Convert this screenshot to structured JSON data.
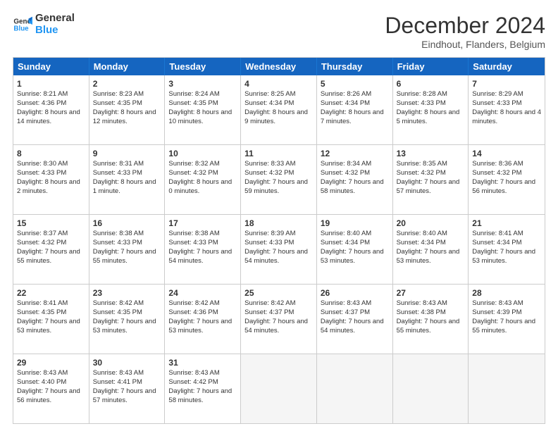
{
  "logo": {
    "line1": "General",
    "line2": "Blue"
  },
  "title": "December 2024",
  "location": "Eindhout, Flanders, Belgium",
  "weekdays": [
    "Sunday",
    "Monday",
    "Tuesday",
    "Wednesday",
    "Thursday",
    "Friday",
    "Saturday"
  ],
  "rows": [
    [
      {
        "day": "1",
        "sunrise": "Sunrise: 8:21 AM",
        "sunset": "Sunset: 4:36 PM",
        "daylight": "Daylight: 8 hours and 14 minutes."
      },
      {
        "day": "2",
        "sunrise": "Sunrise: 8:23 AM",
        "sunset": "Sunset: 4:35 PM",
        "daylight": "Daylight: 8 hours and 12 minutes."
      },
      {
        "day": "3",
        "sunrise": "Sunrise: 8:24 AM",
        "sunset": "Sunset: 4:35 PM",
        "daylight": "Daylight: 8 hours and 10 minutes."
      },
      {
        "day": "4",
        "sunrise": "Sunrise: 8:25 AM",
        "sunset": "Sunset: 4:34 PM",
        "daylight": "Daylight: 8 hours and 9 minutes."
      },
      {
        "day": "5",
        "sunrise": "Sunrise: 8:26 AM",
        "sunset": "Sunset: 4:34 PM",
        "daylight": "Daylight: 8 hours and 7 minutes."
      },
      {
        "day": "6",
        "sunrise": "Sunrise: 8:28 AM",
        "sunset": "Sunset: 4:33 PM",
        "daylight": "Daylight: 8 hours and 5 minutes."
      },
      {
        "day": "7",
        "sunrise": "Sunrise: 8:29 AM",
        "sunset": "Sunset: 4:33 PM",
        "daylight": "Daylight: 8 hours and 4 minutes."
      }
    ],
    [
      {
        "day": "8",
        "sunrise": "Sunrise: 8:30 AM",
        "sunset": "Sunset: 4:33 PM",
        "daylight": "Daylight: 8 hours and 2 minutes."
      },
      {
        "day": "9",
        "sunrise": "Sunrise: 8:31 AM",
        "sunset": "Sunset: 4:33 PM",
        "daylight": "Daylight: 8 hours and 1 minute."
      },
      {
        "day": "10",
        "sunrise": "Sunrise: 8:32 AM",
        "sunset": "Sunset: 4:32 PM",
        "daylight": "Daylight: 8 hours and 0 minutes."
      },
      {
        "day": "11",
        "sunrise": "Sunrise: 8:33 AM",
        "sunset": "Sunset: 4:32 PM",
        "daylight": "Daylight: 7 hours and 59 minutes."
      },
      {
        "day": "12",
        "sunrise": "Sunrise: 8:34 AM",
        "sunset": "Sunset: 4:32 PM",
        "daylight": "Daylight: 7 hours and 58 minutes."
      },
      {
        "day": "13",
        "sunrise": "Sunrise: 8:35 AM",
        "sunset": "Sunset: 4:32 PM",
        "daylight": "Daylight: 7 hours and 57 minutes."
      },
      {
        "day": "14",
        "sunrise": "Sunrise: 8:36 AM",
        "sunset": "Sunset: 4:32 PM",
        "daylight": "Daylight: 7 hours and 56 minutes."
      }
    ],
    [
      {
        "day": "15",
        "sunrise": "Sunrise: 8:37 AM",
        "sunset": "Sunset: 4:32 PM",
        "daylight": "Daylight: 7 hours and 55 minutes."
      },
      {
        "day": "16",
        "sunrise": "Sunrise: 8:38 AM",
        "sunset": "Sunset: 4:33 PM",
        "daylight": "Daylight: 7 hours and 55 minutes."
      },
      {
        "day": "17",
        "sunrise": "Sunrise: 8:38 AM",
        "sunset": "Sunset: 4:33 PM",
        "daylight": "Daylight: 7 hours and 54 minutes."
      },
      {
        "day": "18",
        "sunrise": "Sunrise: 8:39 AM",
        "sunset": "Sunset: 4:33 PM",
        "daylight": "Daylight: 7 hours and 54 minutes."
      },
      {
        "day": "19",
        "sunrise": "Sunrise: 8:40 AM",
        "sunset": "Sunset: 4:34 PM",
        "daylight": "Daylight: 7 hours and 53 minutes."
      },
      {
        "day": "20",
        "sunrise": "Sunrise: 8:40 AM",
        "sunset": "Sunset: 4:34 PM",
        "daylight": "Daylight: 7 hours and 53 minutes."
      },
      {
        "day": "21",
        "sunrise": "Sunrise: 8:41 AM",
        "sunset": "Sunset: 4:34 PM",
        "daylight": "Daylight: 7 hours and 53 minutes."
      }
    ],
    [
      {
        "day": "22",
        "sunrise": "Sunrise: 8:41 AM",
        "sunset": "Sunset: 4:35 PM",
        "daylight": "Daylight: 7 hours and 53 minutes."
      },
      {
        "day": "23",
        "sunrise": "Sunrise: 8:42 AM",
        "sunset": "Sunset: 4:35 PM",
        "daylight": "Daylight: 7 hours and 53 minutes."
      },
      {
        "day": "24",
        "sunrise": "Sunrise: 8:42 AM",
        "sunset": "Sunset: 4:36 PM",
        "daylight": "Daylight: 7 hours and 53 minutes."
      },
      {
        "day": "25",
        "sunrise": "Sunrise: 8:42 AM",
        "sunset": "Sunset: 4:37 PM",
        "daylight": "Daylight: 7 hours and 54 minutes."
      },
      {
        "day": "26",
        "sunrise": "Sunrise: 8:43 AM",
        "sunset": "Sunset: 4:37 PM",
        "daylight": "Daylight: 7 hours and 54 minutes."
      },
      {
        "day": "27",
        "sunrise": "Sunrise: 8:43 AM",
        "sunset": "Sunset: 4:38 PM",
        "daylight": "Daylight: 7 hours and 55 minutes."
      },
      {
        "day": "28",
        "sunrise": "Sunrise: 8:43 AM",
        "sunset": "Sunset: 4:39 PM",
        "daylight": "Daylight: 7 hours and 55 minutes."
      }
    ],
    [
      {
        "day": "29",
        "sunrise": "Sunrise: 8:43 AM",
        "sunset": "Sunset: 4:40 PM",
        "daylight": "Daylight: 7 hours and 56 minutes."
      },
      {
        "day": "30",
        "sunrise": "Sunrise: 8:43 AM",
        "sunset": "Sunset: 4:41 PM",
        "daylight": "Daylight: 7 hours and 57 minutes."
      },
      {
        "day": "31",
        "sunrise": "Sunrise: 8:43 AM",
        "sunset": "Sunset: 4:42 PM",
        "daylight": "Daylight: 7 hours and 58 minutes."
      },
      null,
      null,
      null,
      null
    ]
  ]
}
